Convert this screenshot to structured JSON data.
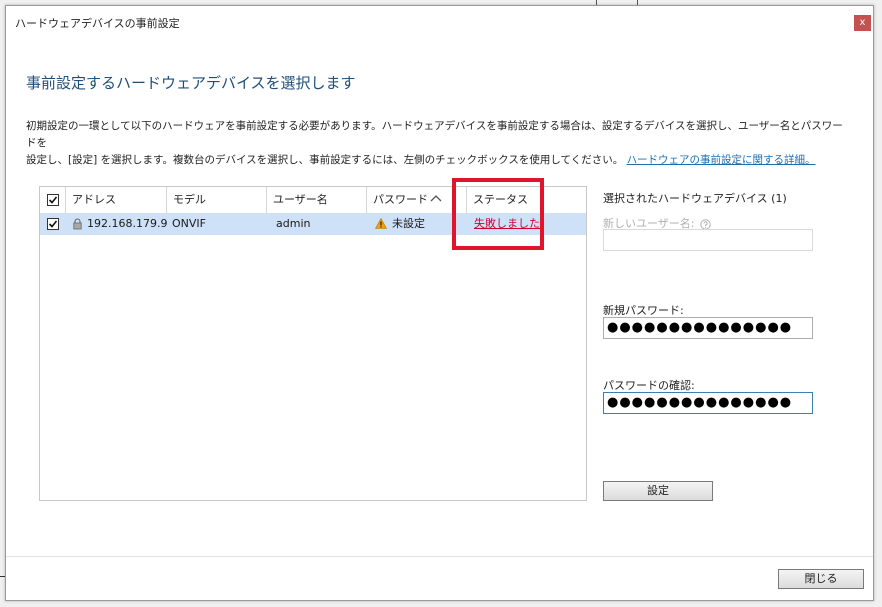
{
  "window": {
    "title": "ハードウェアデバイスの事前設定",
    "close_glyph": "x"
  },
  "heading": "事前設定するハードウェアデバイスを選択します",
  "description": {
    "line1": "初期設定の一環として以下のハードウェアを事前設定する必要があります。ハードウェアデバイスを事前設定する場合は、設定するデバイスを選択し、ユーザー名とパスワードを",
    "line2": "設定し、[設定] を選択します。複数台のデバイスを選択し、事前設定するには、左側のチェックボックスを使用してください。",
    "link": "ハードウェアの事前設定に関する詳細。"
  },
  "table": {
    "columns": [
      "アドレス",
      "モデル",
      "ユーザー名",
      "パスワード",
      "ステータス"
    ],
    "rows": [
      {
        "checked": true,
        "address": "192.168.179.9",
        "model": "ONVIF",
        "username": "admin",
        "password_status": "未設定",
        "status": "失敗しました"
      }
    ]
  },
  "right_panel": {
    "title": "選択されたハードウェアデバイス (1)",
    "new_username_label": "新しいユーザー名:",
    "new_username_value": "",
    "new_password_label": "新規パスワード:",
    "new_password_value": "●●●●●●●●●●●●●●●",
    "confirm_password_label": "パスワードの確認:",
    "confirm_password_value": "●●●●●●●●●●●●●●●",
    "set_button": "設定"
  },
  "footer": {
    "close_button": "閉じる"
  },
  "colors": {
    "heading": "#1f4e79",
    "link": "#1a6fb3",
    "status_error": "#d0003a",
    "row_selected": "#cfe1f7",
    "highlight": "#e0142a",
    "close_button": "#c75050"
  }
}
